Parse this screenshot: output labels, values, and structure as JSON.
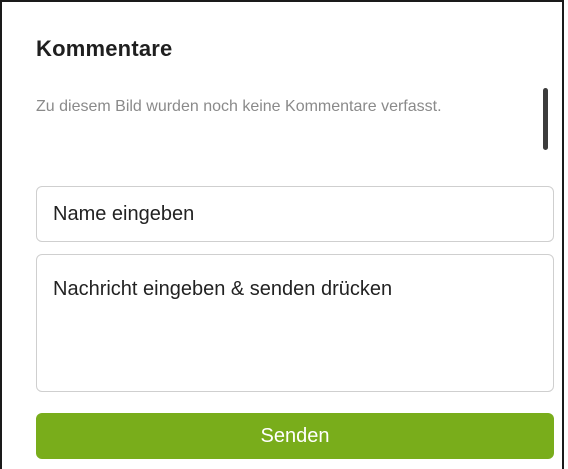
{
  "comments": {
    "title": "Kommentare",
    "empty_message": "Zu diesem Bild wurden noch keine Kommentare verfasst."
  },
  "form": {
    "name_placeholder": "Name eingeben",
    "message_placeholder": "Nachricht eingeben & senden drücken",
    "send_label": "Senden"
  },
  "colors": {
    "accent": "#79ad1b",
    "muted_text": "#8a8a8a",
    "field_border": "#cfcfcf"
  }
}
